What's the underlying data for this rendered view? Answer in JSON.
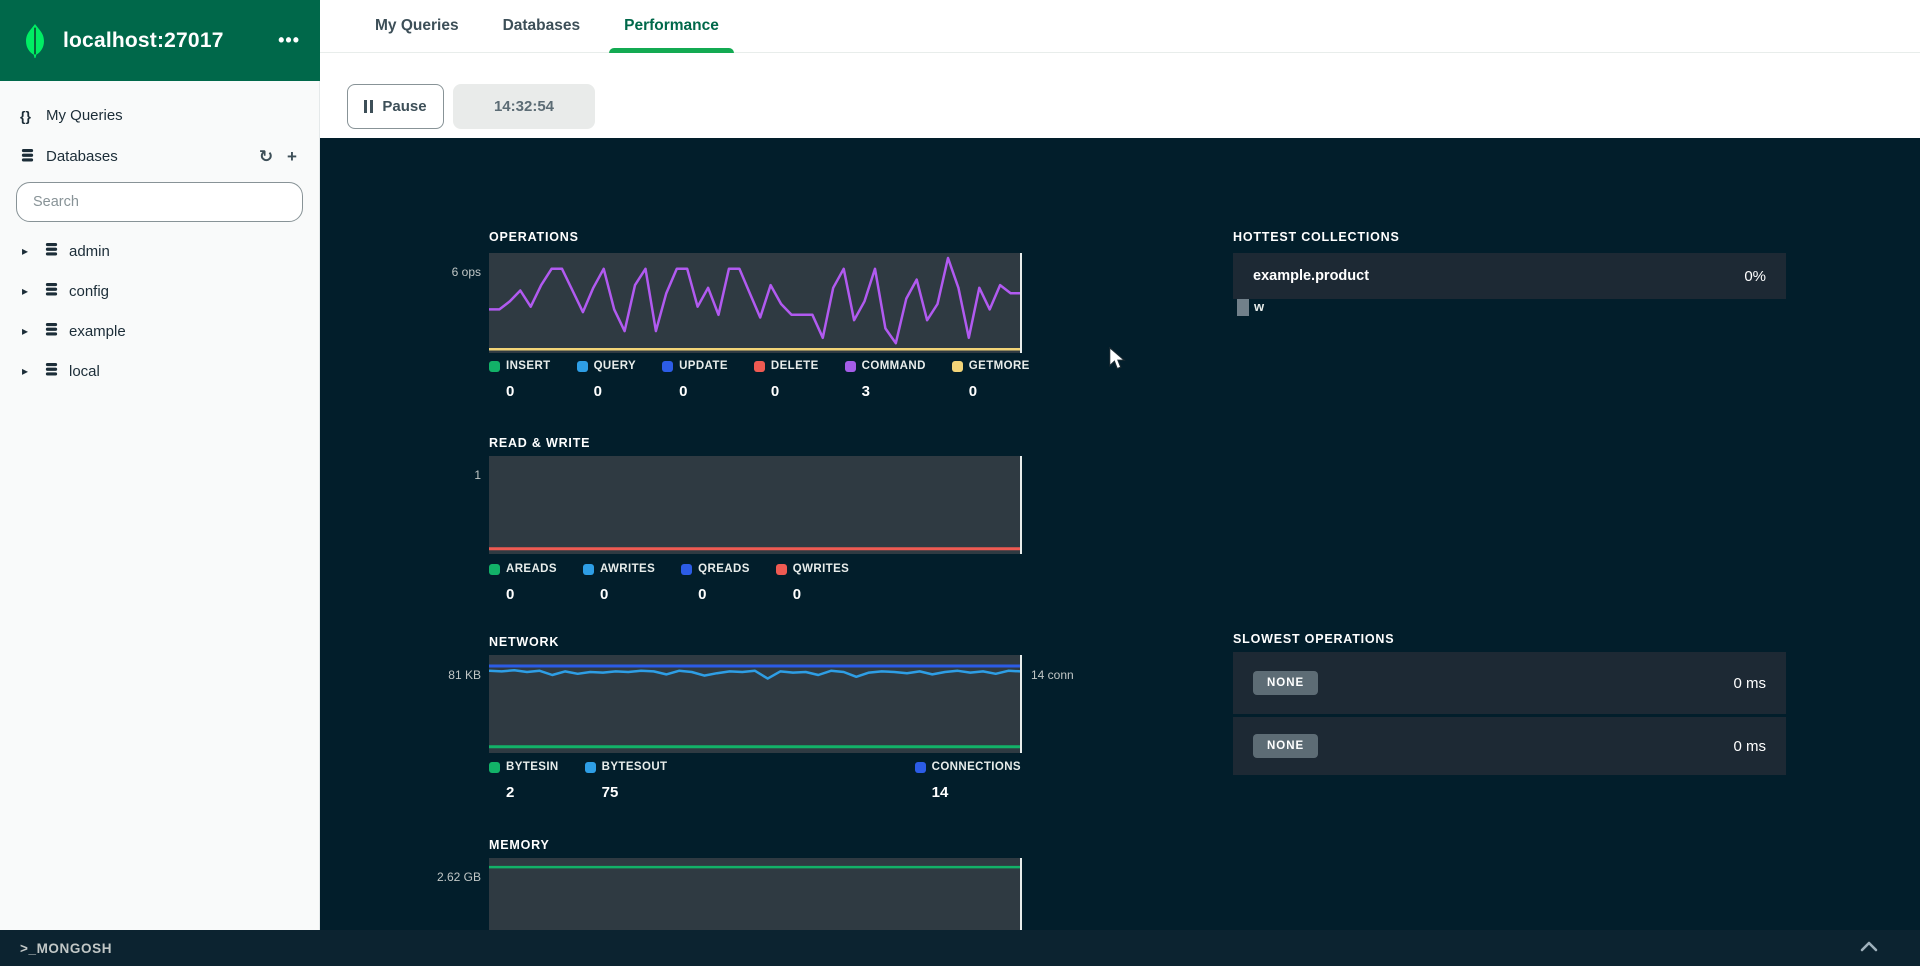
{
  "header": {
    "connection_name": "localhost:27017",
    "menu_label": "•••"
  },
  "sidebar": {
    "my_queries_label": "My Queries",
    "my_queries_icon": "{}",
    "databases_label": "Databases",
    "refresh_icon": "↻",
    "add_icon": "+",
    "search_placeholder": "Search",
    "caret_icon": "▸",
    "databases": [
      "admin",
      "config",
      "example",
      "local"
    ]
  },
  "tabs": {
    "items": [
      {
        "label": "My Queries"
      },
      {
        "label": "Databases"
      },
      {
        "label": "Performance"
      }
    ]
  },
  "toolbar": {
    "pause_label": "Pause",
    "time": "14:32:54"
  },
  "statusbar": {
    "label": ">_MONGOSH"
  },
  "charts": {
    "operations": {
      "title": "OPERATIONS",
      "y_label": "6 ops",
      "ymax": 6.8,
      "series": [
        {
          "name": "command",
          "color": "#B15AF0",
          "width": 2.5,
          "values": [
            3,
            3,
            3.6,
            4.4,
            3.2,
            4.8,
            6,
            6,
            4.4,
            2.8,
            4.6,
            6,
            3,
            1.4,
            4.8,
            6,
            1.4,
            4.2,
            6,
            6,
            3.2,
            4.6,
            2.6,
            6,
            6,
            4.2,
            2.4,
            4.8,
            3.4,
            2.6,
            2.6,
            2.6,
            0.9,
            4.6,
            6,
            2.2,
            3.6,
            6,
            1.6,
            0.5,
            3.8,
            5.2,
            2.2,
            3.4,
            6.8,
            4.6,
            0.9,
            4.6,
            3,
            4.8,
            4.2,
            4.2
          ]
        },
        {
          "name": "getmore",
          "color": "#F2D478",
          "width": 2.5,
          "values": [
            0.05,
            0.05
          ]
        }
      ],
      "legend": [
        {
          "label": "INSERT",
          "value": "0",
          "color": "#12B268"
        },
        {
          "label": "QUERY",
          "value": "0",
          "color": "#2E9EE5"
        },
        {
          "label": "UPDATE",
          "value": "0",
          "color": "#2C5CE6"
        },
        {
          "label": "DELETE",
          "value": "0",
          "color": "#EF5A52"
        },
        {
          "label": "COMMAND",
          "value": "3",
          "color": "#A35DE8"
        },
        {
          "label": "GETMORE",
          "value": "0",
          "color": "#F2D478"
        }
      ]
    },
    "read_write": {
      "title": "READ & WRITE",
      "y_label": "1",
      "ymax": 1,
      "series": [
        {
          "name": "qwrites",
          "color": "#EF5A52",
          "width": 3,
          "values": [
            0.025,
            0.025
          ]
        }
      ],
      "legend": [
        {
          "label": "AREADS",
          "value": "0",
          "color": "#12B268"
        },
        {
          "label": "AWRITES",
          "value": "0",
          "color": "#2E9EE5"
        },
        {
          "label": "QREADS",
          "value": "0",
          "color": "#2C5CE6"
        },
        {
          "label": "QWRITES",
          "value": "0",
          "color": "#EF5A52"
        }
      ]
    },
    "network": {
      "title": "NETWORK",
      "y_label": "81 KB",
      "y_label_right": "14 conn",
      "ymax": 15,
      "series": [
        {
          "name": "connections",
          "color": "#2C5CE6",
          "width": 3,
          "values": [
            14,
            14
          ]
        },
        {
          "name": "bytesout",
          "color": "#2E9EE5",
          "width": 2.5,
          "values": [
            13.2,
            13.1,
            13.3,
            13,
            13.2,
            12.5,
            13.1,
            12.7,
            13,
            12.9,
            13.1,
            13,
            13.2,
            13.1,
            12.6,
            13.2,
            13,
            12.4,
            12.8,
            13.1,
            13,
            13.2,
            11.9,
            13.1,
            12.9,
            13,
            12.5,
            13.2,
            13,
            12.2,
            12.9,
            13.1,
            13,
            12.8,
            13.1,
            12.6,
            13,
            13.2,
            12.9,
            13.1,
            12.7,
            13.2,
            13.1
          ]
        },
        {
          "name": "bytesin",
          "color": "#12B268",
          "width": 3,
          "values": [
            0.55,
            0.55
          ]
        }
      ],
      "legend": [
        {
          "label": "BYTESIN",
          "value": "2",
          "color": "#12B268"
        },
        {
          "label": "BYTESOUT",
          "value": "75",
          "color": "#2E9EE5"
        },
        {
          "label": "CONNECTIONS",
          "value": "14",
          "color": "#2C5CE6"
        }
      ]
    },
    "memory": {
      "title": "MEMORY",
      "y_label": "2.62 GB",
      "ymax": 2.75,
      "series": [
        {
          "name": "virtual",
          "color": "#12B268",
          "width": 2.5,
          "values": [
            2.62,
            2.62
          ]
        }
      ]
    }
  },
  "hottest": {
    "title": "HOTTEST COLLECTIONS",
    "rows": [
      {
        "collection": "example.product",
        "percent": "0%"
      }
    ],
    "partial_label": "w"
  },
  "slowest": {
    "title": "SLOWEST OPERATIONS",
    "rows": [
      {
        "badge": "NONE",
        "value": "0 ms"
      },
      {
        "badge": "NONE",
        "value": "0 ms"
      }
    ]
  }
}
